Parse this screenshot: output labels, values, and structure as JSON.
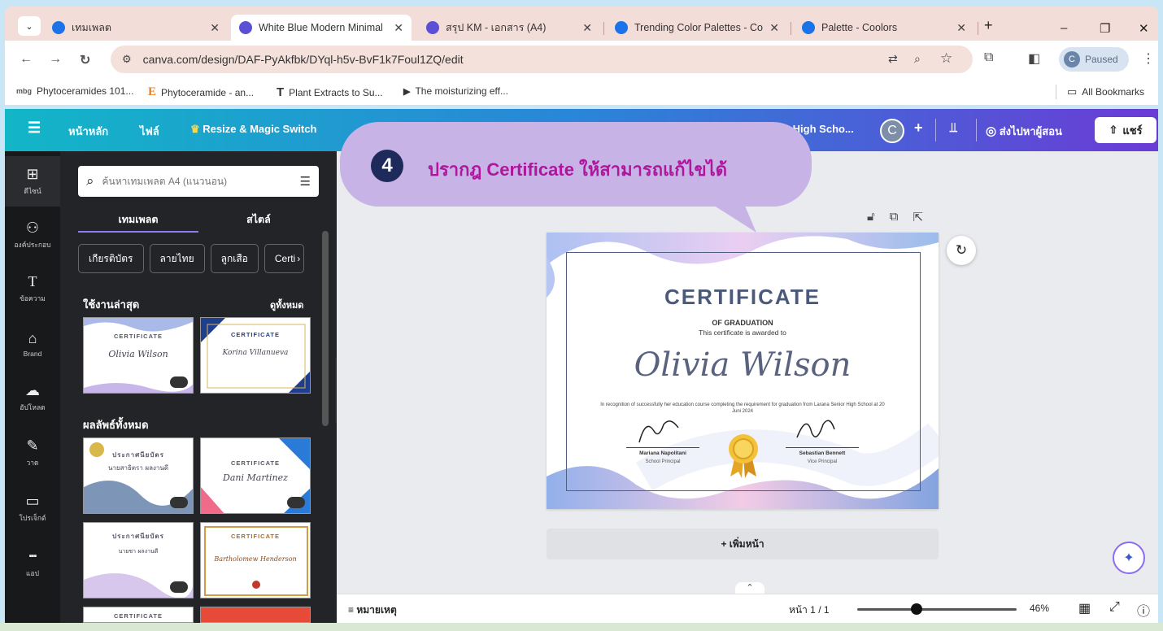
{
  "browser": {
    "tabs": [
      {
        "title": "เทมเพลต",
        "favicon_color": "#1a73e8"
      },
      {
        "title": "White Blue Modern Minimal",
        "favicon_color": "#5b4fd6"
      },
      {
        "title": "สรุป KM - เอกสาร (A4)",
        "favicon_color": "#5b4fd6"
      },
      {
        "title": "Trending Color Palettes - Co",
        "favicon_color": "#1a73e8"
      },
      {
        "title": "Palette - Coolors",
        "favicon_color": "#1a73e8"
      }
    ],
    "new_tab": "+",
    "window_controls": {
      "minimize": "–",
      "restore": "❐",
      "close": "✕"
    },
    "url": "canva.com/design/DAF-PyAkfbk/DYql-h5v-BvF1k7Foul1ZQ/edit",
    "profile_initial": "C",
    "profile_status": "Paused",
    "bookmarks": [
      {
        "icon": "mbg",
        "label": "Phytoceramides 101..."
      },
      {
        "icon": "E",
        "label": "Phytoceramide - an..."
      },
      {
        "icon": "T",
        "label": "Plant Extracts to Su..."
      },
      {
        "icon": "▶",
        "label": "The moisturizing eff..."
      }
    ],
    "all_bookmarks": "All Bookmarks"
  },
  "canva": {
    "topbar": {
      "home": "หน้าหลัก",
      "file": "ไฟล์",
      "resize": "Resize & Magic Switch",
      "doc_title": "r High Scho...",
      "avatar_initial": "C",
      "send_to_teacher": "ส่งไปหาผู้สอน",
      "share": "แชร์"
    },
    "rail": [
      {
        "icon": "layout-icon",
        "glyph": "⊞",
        "label": "ดีไซน์"
      },
      {
        "icon": "elements-icon",
        "glyph": "⚇",
        "label": "องค์ประกอบ"
      },
      {
        "icon": "text-icon",
        "glyph": "T",
        "label": "ข้อความ"
      },
      {
        "icon": "brand-icon",
        "glyph": "⌂",
        "label": "Brand"
      },
      {
        "icon": "upload-icon",
        "glyph": "☁",
        "label": "อัปโหลด"
      },
      {
        "icon": "draw-icon",
        "glyph": "✎",
        "label": "วาด"
      },
      {
        "icon": "folder-icon",
        "glyph": "▭",
        "label": "โปรเจ็กต์"
      },
      {
        "icon": "apps-icon",
        "glyph": "⋮⋮⋮",
        "label": "แอป"
      }
    ],
    "panel": {
      "search_placeholder": "ค้นหาเทมเพลต A4 (แนวนอน)",
      "tabs": [
        "เทมเพลต",
        "สไตล์"
      ],
      "chips": [
        "เกียรติบัตร",
        "ลายไทย",
        "ลูกเสือ",
        "Certi"
      ],
      "recent_heading": "ใช้งานล่าสุด",
      "see_all": "ดูทั้งหมด",
      "all_results_heading": "ผลลัพธ์ทั้งหมด",
      "thumbs": [
        {
          "title": "CERTIFICATE",
          "name": "Olivia Wilson"
        },
        {
          "title": "CERTIFICATE",
          "name": "Korina Villanueva"
        },
        {
          "title": "ประกาศนียบัตร",
          "name": "นายสาธิตรา ผลงานดี"
        },
        {
          "title": "CERTIFICATE",
          "name": "Dani Martinez"
        },
        {
          "title": "ประกาศนียบัตร",
          "name": "นายชา ผลงานดี"
        },
        {
          "title": "CERTIFICATE",
          "name": "Bartholomew Henderson"
        },
        {
          "title": "CERTIFICATE",
          "name": ""
        },
        {
          "title": "",
          "name": ""
        }
      ]
    },
    "certificate": {
      "title": "CERTIFICATE",
      "subtitle": "OF GRADUATION",
      "awarded": "This certificate is awarded to",
      "name": "Olivia Wilson",
      "body": "In recognition of successfully her education course completing the requirement for graduation from Larana Senior High School at 20 Juni 2024",
      "sig1_name": "Mariana Napolitani",
      "sig1_role": "School Principal",
      "sig2_name": "Sebastian Bennett",
      "sig2_role": "Vice Principal"
    },
    "add_page": "+ เพิ่มหน้า",
    "bottombar": {
      "notes": "หมายเหตุ",
      "page": "หน้า 1 / 1",
      "zoom": "46%",
      "zoom_fraction": 0.46
    }
  },
  "callout": {
    "step": "4",
    "text": "ปรากฎ Certificate ให้สามารถแก้ไขได้"
  }
}
